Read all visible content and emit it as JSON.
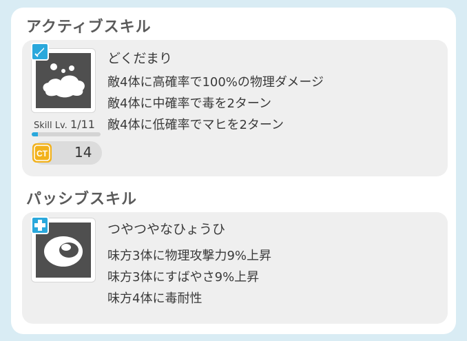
{
  "active": {
    "section_title": "アクティブスキル",
    "skill_name": "どくだまり",
    "icon": "poison-puddle-icon",
    "type_icon": "sword-icon",
    "effects": [
      "敵4体に高確率で100%の物理ダメージ",
      "敵4体に中確率で毒を2ターン",
      "敵4体に低確率でマヒを2ターン"
    ],
    "level_label": "Skill Lv.",
    "level_value": "1/11",
    "level_progress": 0.09,
    "ct_label": "CT",
    "ct_value": "14"
  },
  "passive": {
    "section_title": "パッシブスキル",
    "skill_name": "つやつやなひょうひ",
    "icon": "glossy-skin-icon",
    "type_icon": "plus-icon",
    "effects": [
      "味方3体に物理攻撃力9%上昇",
      "味方3体にすばやさ9%上昇",
      "味方4体に毒耐性"
    ]
  },
  "colors": {
    "accent_blue": "#2aa8dc",
    "ct_gold": "#f2b21c",
    "card_bg": "#efefef",
    "icon_dark": "#4f4f4f"
  }
}
